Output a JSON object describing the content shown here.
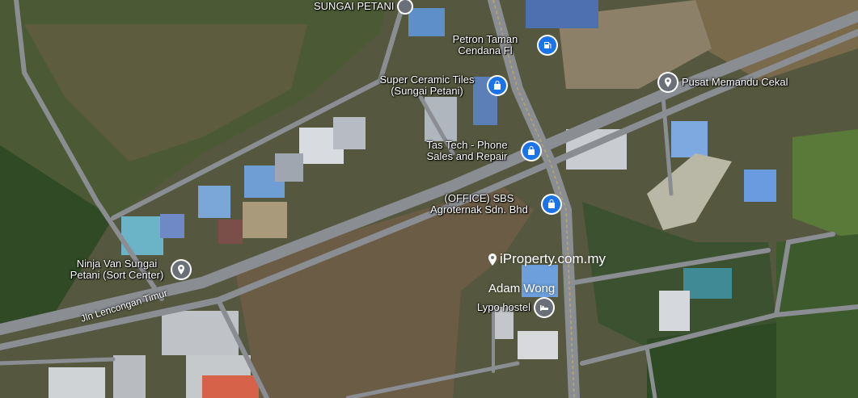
{
  "map": {
    "colors": {
      "road": "#7b7f86",
      "roadMajor": "#8e9196",
      "vegetation": "#3f5a2b",
      "bare": "#6a5d43",
      "roof_blue": "#5f8fc9",
      "roof_white": "#d9dde2",
      "pin_blue": "#1a73e8"
    },
    "labels": {
      "sungai_petani": "SUNGAI PETANI",
      "petron": "Petron Taman Cendana Fl",
      "super_ceramic": "Super Ceramic Tiles (Sungai Petani)",
      "tas_tech": "Tas Tech - Phone Sales and Repair",
      "sbs": "(OFFICE) SBS Agroternak Sdn. Bhd",
      "pusat": "Pusat Memandu Cekal",
      "ninja_van": "Ninja Van Sungai Petani (Sort Center)",
      "lypo": "Lypo hostel",
      "road_jln": "Jln Lencongan Timur"
    },
    "watermark": {
      "site": "iProperty.com.my",
      "agent": "Adam Wong"
    }
  }
}
